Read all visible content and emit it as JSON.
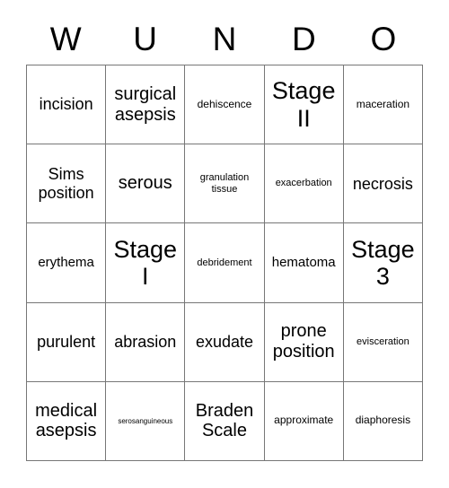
{
  "card": {
    "title": "Bingo Card",
    "columns": 5,
    "rows": 5,
    "border_color": "#777777",
    "text_color": "#000000",
    "background_color": "#ffffff"
  },
  "header": {
    "letters": [
      "W",
      "U",
      "N",
      "D",
      "O"
    ]
  },
  "grid": {
    "rows": [
      {
        "cells": [
          {
            "text": "incision",
            "size": "lg"
          },
          {
            "text": "surgical asepsis",
            "size": "xl"
          },
          {
            "text": "dehiscence",
            "size": "sm"
          },
          {
            "text": "Stage II",
            "size": "xxl"
          },
          {
            "text": "maceration",
            "size": "sm"
          }
        ]
      },
      {
        "cells": [
          {
            "text": "Sims position",
            "size": "lg"
          },
          {
            "text": "serous",
            "size": "xl"
          },
          {
            "text": "granulation tissue",
            "size": "xs"
          },
          {
            "text": "exacerbation",
            "size": "xs"
          },
          {
            "text": "necrosis",
            "size": "lg"
          }
        ]
      },
      {
        "cells": [
          {
            "text": "erythema",
            "size": "md"
          },
          {
            "text": "Stage I",
            "size": "xxl"
          },
          {
            "text": "debridement",
            "size": "xs"
          },
          {
            "text": "hematoma",
            "size": "md"
          },
          {
            "text": "Stage 3",
            "size": "xxl"
          }
        ]
      },
      {
        "cells": [
          {
            "text": "purulent",
            "size": "lg"
          },
          {
            "text": "abrasion",
            "size": "lg"
          },
          {
            "text": "exudate",
            "size": "lg"
          },
          {
            "text": "prone position",
            "size": "xl"
          },
          {
            "text": "evisceration",
            "size": "xs"
          }
        ]
      },
      {
        "cells": [
          {
            "text": "medical asepsis",
            "size": "xl"
          },
          {
            "text": "serosanguineous",
            "size": "xxs"
          },
          {
            "text": "Braden Scale",
            "size": "xl"
          },
          {
            "text": "approximate",
            "size": "sm"
          },
          {
            "text": "diaphoresis",
            "size": "sm"
          }
        ]
      }
    ]
  }
}
